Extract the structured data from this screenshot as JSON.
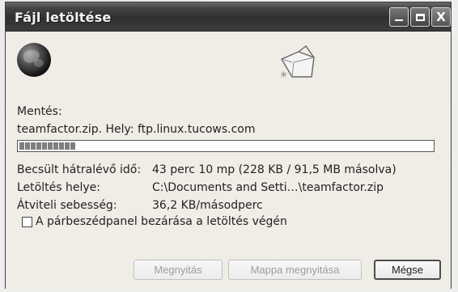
{
  "window": {
    "title": "Fájl letöltése",
    "controls": {
      "minimize": "",
      "maximize": "",
      "close": "X"
    }
  },
  "download": {
    "saving_label": "Mentés:",
    "file_line": "teamfactor.zip. Hely: ftp.linux.tucows.com",
    "progress_fraction": 0.13,
    "estimated_time_label": "Becsült hátralévő idő:",
    "estimated_time_value": "43 perc 10 mp (228 KB / 91,5 MB másolva)",
    "download_location_label": "Letöltés helye:",
    "download_location_value": "C:\\Documents and Setti…\\teamfactor.zip",
    "transfer_speed_label": "Átviteli sebesség:",
    "transfer_speed_value": "36,2 KB/másodperc",
    "close_on_complete_label": "A párbeszédpanel bezárása a letöltés végén"
  },
  "buttons": {
    "open": "Megnyitás",
    "open_folder": "Mappa megnyitása",
    "cancel": "Mégse"
  },
  "icons": {
    "globe": "globe-icon",
    "folder": "folder-icon",
    "sparkle": "sparkle-icon",
    "checkbox": "checkbox-icon"
  },
  "colors": {
    "title_bar": "#3a3a3a",
    "dialog_background": "#efede6",
    "progress_fill": "#7e7e7e",
    "text": "#222222"
  }
}
